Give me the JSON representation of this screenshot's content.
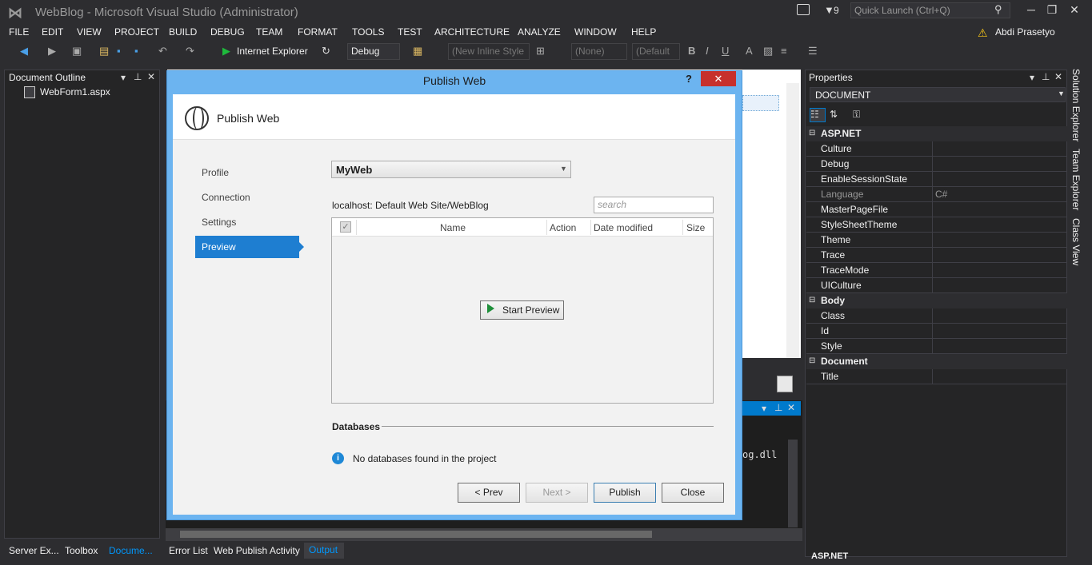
{
  "window": {
    "title": "WebBlog - Microsoft Visual Studio (Administrator)",
    "filter_count": "9",
    "quick_launch_placeholder": "Quick Launch (Ctrl+Q)",
    "user": "Abdi Prasetyo"
  },
  "menu": [
    "FILE",
    "EDIT",
    "VIEW",
    "PROJECT",
    "BUILD",
    "DEBUG",
    "TEAM",
    "FORMAT",
    "TOOLS",
    "TEST",
    "ARCHITECTURE",
    "ANALYZE",
    "WINDOW",
    "HELP"
  ],
  "toolbar": {
    "run_target": "Internet Explorer",
    "config": "Debug",
    "style_combo": "(New Inline Style",
    "target_combo": "(None)",
    "font_combo": "(Default"
  },
  "left_panel": {
    "title": "Document Outline",
    "tree_item": "WebForm1.aspx",
    "tabs": [
      "Server Ex...",
      "Toolbox",
      "Docume..."
    ]
  },
  "output": {
    "text": "og.dll",
    "tabs": [
      "Error List",
      "Web Publish Activity",
      "Output"
    ]
  },
  "properties": {
    "title": "Properties",
    "object": "DOCUMENT",
    "categories": [
      {
        "name": "ASP.NET",
        "items": [
          {
            "name": "Culture",
            "value": ""
          },
          {
            "name": "Debug",
            "value": ""
          },
          {
            "name": "EnableSessionState",
            "value": ""
          },
          {
            "name": "Language",
            "value": "C#"
          },
          {
            "name": "MasterPageFile",
            "value": ""
          },
          {
            "name": "StyleSheetTheme",
            "value": ""
          },
          {
            "name": "Theme",
            "value": ""
          },
          {
            "name": "Trace",
            "value": ""
          },
          {
            "name": "TraceMode",
            "value": ""
          },
          {
            "name": "UICulture",
            "value": ""
          }
        ]
      },
      {
        "name": "Body",
        "items": [
          {
            "name": "Class",
            "value": ""
          },
          {
            "name": "Id",
            "value": ""
          },
          {
            "name": "Style",
            "value": ""
          }
        ]
      },
      {
        "name": "Document",
        "items": [
          {
            "name": "Title",
            "value": ""
          }
        ]
      }
    ],
    "footer": "ASP.NET"
  },
  "right_tabs": [
    "Solution Explorer",
    "Team Explorer",
    "Class View"
  ],
  "dialog": {
    "title": "Publish Web",
    "help": "?",
    "close": "✕",
    "heading": "Publish Web",
    "nav": [
      "Profile",
      "Connection",
      "Settings",
      "Preview"
    ],
    "profile": "MyWeb",
    "site_path": "localhost: Default Web Site/WebBlog",
    "search_placeholder": "search",
    "columns": [
      "Name",
      "Action",
      "Date modified",
      "Size"
    ],
    "start_preview": "Start Preview",
    "databases_heading": "Databases",
    "databases_message": "No databases found in the project",
    "buttons": {
      "prev": "< Prev",
      "next": "Next >",
      "publish": "Publish",
      "close": "Close"
    }
  }
}
